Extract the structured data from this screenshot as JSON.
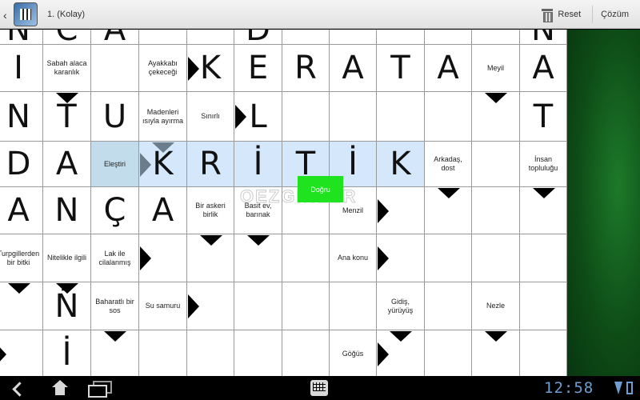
{
  "header": {
    "title": "1. (Kolay)",
    "reset_label": "Reset",
    "solution_label": "Çözüm"
  },
  "grid": {
    "cells": [
      {
        "row": 0,
        "col": 0,
        "type": "letter",
        "text": "N"
      },
      {
        "row": 0,
        "col": 1,
        "type": "letter",
        "text": "C"
      },
      {
        "row": 0,
        "col": 2,
        "type": "letter",
        "text": "A"
      },
      {
        "row": 0,
        "col": 3,
        "type": "empty",
        "text": ""
      },
      {
        "row": 0,
        "col": 4,
        "type": "empty",
        "text": ""
      },
      {
        "row": 0,
        "col": 5,
        "type": "letter",
        "text": "D"
      },
      {
        "row": 0,
        "col": 6,
        "type": "empty",
        "text": ""
      },
      {
        "row": 0,
        "col": 7,
        "type": "empty",
        "text": ""
      },
      {
        "row": 0,
        "col": 8,
        "type": "empty",
        "text": ""
      },
      {
        "row": 0,
        "col": 9,
        "type": "empty",
        "text": ""
      },
      {
        "row": 0,
        "col": 10,
        "type": "empty",
        "text": ""
      },
      {
        "row": 0,
        "col": 11,
        "type": "letter",
        "text": "N"
      },
      {
        "row": 1,
        "col": 0,
        "type": "letter",
        "text": "I"
      },
      {
        "row": 1,
        "col": 1,
        "type": "clue",
        "text": "Sabah alaca karanlık"
      },
      {
        "row": 1,
        "col": 2,
        "type": "empty",
        "text": ""
      },
      {
        "row": 1,
        "col": 3,
        "type": "clue",
        "text": "Ayakkabı çekeceği"
      },
      {
        "row": 1,
        "col": 4,
        "type": "letter",
        "text": "K"
      },
      {
        "row": 1,
        "col": 5,
        "type": "letter",
        "text": "E"
      },
      {
        "row": 1,
        "col": 6,
        "type": "letter",
        "text": "R"
      },
      {
        "row": 1,
        "col": 7,
        "type": "letter",
        "text": "A"
      },
      {
        "row": 1,
        "col": 8,
        "type": "letter",
        "text": "T"
      },
      {
        "row": 1,
        "col": 9,
        "type": "letter",
        "text": "A"
      },
      {
        "row": 1,
        "col": 10,
        "type": "clue",
        "text": "Meyil"
      },
      {
        "row": 1,
        "col": 11,
        "type": "letter",
        "text": "A"
      },
      {
        "row": 2,
        "col": 0,
        "type": "letter",
        "text": "N"
      },
      {
        "row": 2,
        "col": 1,
        "type": "letter",
        "text": "T"
      },
      {
        "row": 2,
        "col": 2,
        "type": "letter",
        "text": "U"
      },
      {
        "row": 2,
        "col": 3,
        "type": "clue",
        "text": "Madenleri ısıyla ayırma"
      },
      {
        "row": 2,
        "col": 4,
        "type": "clue",
        "text": "Sınırlı"
      },
      {
        "row": 2,
        "col": 5,
        "type": "letter",
        "text": "L"
      },
      {
        "row": 2,
        "col": 6,
        "type": "empty",
        "text": ""
      },
      {
        "row": 2,
        "col": 7,
        "type": "empty",
        "text": ""
      },
      {
        "row": 2,
        "col": 8,
        "type": "empty",
        "text": ""
      },
      {
        "row": 2,
        "col": 9,
        "type": "empty",
        "text": ""
      },
      {
        "row": 2,
        "col": 10,
        "type": "empty",
        "text": ""
      },
      {
        "row": 2,
        "col": 11,
        "type": "letter",
        "text": "T"
      },
      {
        "row": 3,
        "col": 0,
        "type": "letter",
        "text": "D"
      },
      {
        "row": 3,
        "col": 1,
        "type": "letter",
        "text": "A"
      },
      {
        "row": 3,
        "col": 2,
        "type": "clue",
        "text": "Eleştiri",
        "state": "selected"
      },
      {
        "row": 3,
        "col": 3,
        "type": "letter",
        "text": "K",
        "state": "highlight"
      },
      {
        "row": 3,
        "col": 4,
        "type": "letter",
        "text": "R",
        "state": "highlight"
      },
      {
        "row": 3,
        "col": 5,
        "type": "letter",
        "text": "İ",
        "state": "highlight"
      },
      {
        "row": 3,
        "col": 6,
        "type": "letter",
        "text": "T",
        "state": "highlight"
      },
      {
        "row": 3,
        "col": 7,
        "type": "letter",
        "text": "İ",
        "state": "highlight"
      },
      {
        "row": 3,
        "col": 8,
        "type": "letter",
        "text": "K",
        "state": "highlight"
      },
      {
        "row": 3,
        "col": 9,
        "type": "clue",
        "text": "Arkadaş, dost"
      },
      {
        "row": 3,
        "col": 10,
        "type": "empty",
        "text": ""
      },
      {
        "row": 3,
        "col": 11,
        "type": "clue",
        "text": "İnsan topluluğu"
      },
      {
        "row": 4,
        "col": 0,
        "type": "letter",
        "text": "A"
      },
      {
        "row": 4,
        "col": 1,
        "type": "letter",
        "text": "N"
      },
      {
        "row": 4,
        "col": 2,
        "type": "letter",
        "text": "Ç"
      },
      {
        "row": 4,
        "col": 3,
        "type": "letter",
        "text": "A"
      },
      {
        "row": 4,
        "col": 4,
        "type": "clue",
        "text": "Bir askeri birlik"
      },
      {
        "row": 4,
        "col": 5,
        "type": "clue",
        "text": "Basit ev, barınak"
      },
      {
        "row": 4,
        "col": 6,
        "type": "empty",
        "text": ""
      },
      {
        "row": 4,
        "col": 7,
        "type": "clue",
        "text": "Menzil"
      },
      {
        "row": 4,
        "col": 8,
        "type": "empty",
        "text": ""
      },
      {
        "row": 4,
        "col": 9,
        "type": "empty",
        "text": ""
      },
      {
        "row": 4,
        "col": 10,
        "type": "empty",
        "text": ""
      },
      {
        "row": 4,
        "col": 11,
        "type": "empty",
        "text": ""
      },
      {
        "row": 5,
        "col": 0,
        "type": "clue",
        "text": "Turpgillerden bir bitki"
      },
      {
        "row": 5,
        "col": 1,
        "type": "clue",
        "text": "Nitelikle ilgili"
      },
      {
        "row": 5,
        "col": 2,
        "type": "clue",
        "text": "Lak ile cilalanmış"
      },
      {
        "row": 5,
        "col": 3,
        "type": "empty",
        "text": ""
      },
      {
        "row": 5,
        "col": 4,
        "type": "empty",
        "text": ""
      },
      {
        "row": 5,
        "col": 5,
        "type": "empty",
        "text": ""
      },
      {
        "row": 5,
        "col": 6,
        "type": "empty",
        "text": ""
      },
      {
        "row": 5,
        "col": 7,
        "type": "clue",
        "text": "Ana konu"
      },
      {
        "row": 5,
        "col": 8,
        "type": "empty",
        "text": ""
      },
      {
        "row": 5,
        "col": 9,
        "type": "empty",
        "text": ""
      },
      {
        "row": 5,
        "col": 10,
        "type": "empty",
        "text": ""
      },
      {
        "row": 5,
        "col": 11,
        "type": "empty",
        "text": ""
      },
      {
        "row": 6,
        "col": 0,
        "type": "empty",
        "text": ""
      },
      {
        "row": 6,
        "col": 1,
        "type": "letter",
        "text": "Ñ"
      },
      {
        "row": 6,
        "col": 2,
        "type": "clue",
        "text": "Baharatlı bir sos"
      },
      {
        "row": 6,
        "col": 3,
        "type": "clue",
        "text": "Su samuru"
      },
      {
        "row": 6,
        "col": 4,
        "type": "empty",
        "text": ""
      },
      {
        "row": 6,
        "col": 5,
        "type": "empty",
        "text": ""
      },
      {
        "row": 6,
        "col": 6,
        "type": "empty",
        "text": ""
      },
      {
        "row": 6,
        "col": 7,
        "type": "empty",
        "text": ""
      },
      {
        "row": 6,
        "col": 8,
        "type": "clue",
        "text": "Gidiş, yürüyüş"
      },
      {
        "row": 6,
        "col": 9,
        "type": "empty",
        "text": ""
      },
      {
        "row": 6,
        "col": 10,
        "type": "clue",
        "text": "Nezle"
      },
      {
        "row": 6,
        "col": 11,
        "type": "empty",
        "text": ""
      },
      {
        "row": 7,
        "col": 0,
        "type": "empty",
        "text": ""
      },
      {
        "row": 7,
        "col": 1,
        "type": "letter",
        "text": "İ"
      },
      {
        "row": 7,
        "col": 2,
        "type": "empty",
        "text": ""
      },
      {
        "row": 7,
        "col": 3,
        "type": "empty",
        "text": ""
      },
      {
        "row": 7,
        "col": 4,
        "type": "empty",
        "text": ""
      },
      {
        "row": 7,
        "col": 5,
        "type": "empty",
        "text": ""
      },
      {
        "row": 7,
        "col": 6,
        "type": "empty",
        "text": ""
      },
      {
        "row": 7,
        "col": 7,
        "type": "clue",
        "text": "Göğüs"
      },
      {
        "row": 7,
        "col": 8,
        "type": "empty",
        "text": ""
      },
      {
        "row": 7,
        "col": 9,
        "type": "empty",
        "text": ""
      },
      {
        "row": 7,
        "col": 10,
        "type": "empty",
        "text": ""
      },
      {
        "row": 7,
        "col": 11,
        "type": "empty",
        "text": ""
      }
    ],
    "arrows": [
      {
        "row": 1,
        "col": 3,
        "dir": "right"
      },
      {
        "row": 1,
        "col": 1,
        "dir": "down"
      },
      {
        "row": 1,
        "col": 10,
        "dir": "down"
      },
      {
        "row": 2,
        "col": 4,
        "dir": "right"
      },
      {
        "row": 3,
        "col": 2,
        "dir": "right",
        "tone": "grey"
      },
      {
        "row": 2,
        "col": 3,
        "dir": "down",
        "tone": "grey"
      },
      {
        "row": 3,
        "col": 9,
        "dir": "down"
      },
      {
        "row": 3,
        "col": 11,
        "dir": "down"
      },
      {
        "row": 4,
        "col": 4,
        "dir": "down"
      },
      {
        "row": 4,
        "col": 5,
        "dir": "down"
      },
      {
        "row": 4,
        "col": 7,
        "dir": "right"
      },
      {
        "row": 5,
        "col": 0,
        "dir": "down"
      },
      {
        "row": 5,
        "col": 1,
        "dir": "down"
      },
      {
        "row": 5,
        "col": 2,
        "dir": "right"
      },
      {
        "row": 5,
        "col": 7,
        "dir": "right"
      },
      {
        "row": 6,
        "col": 2,
        "dir": "down"
      },
      {
        "row": 6,
        "col": 3,
        "dir": "right"
      },
      {
        "row": 6,
        "col": 8,
        "dir": "down"
      },
      {
        "row": 6,
        "col": 10,
        "dir": "down"
      },
      {
        "row": 7,
        "col": 0,
        "dir": "left-edge"
      },
      {
        "row": 7,
        "col": 7,
        "dir": "right"
      }
    ]
  },
  "toast": {
    "text": "Doğru"
  },
  "watermark": {
    "text": "OEZGINLER"
  },
  "statusbar": {
    "time": "12:58"
  },
  "colors": {
    "board_bg": "#ffffff",
    "highlight": "#d5e8fb",
    "toast": "#1fe31f",
    "clock": "#6f9fd0"
  }
}
